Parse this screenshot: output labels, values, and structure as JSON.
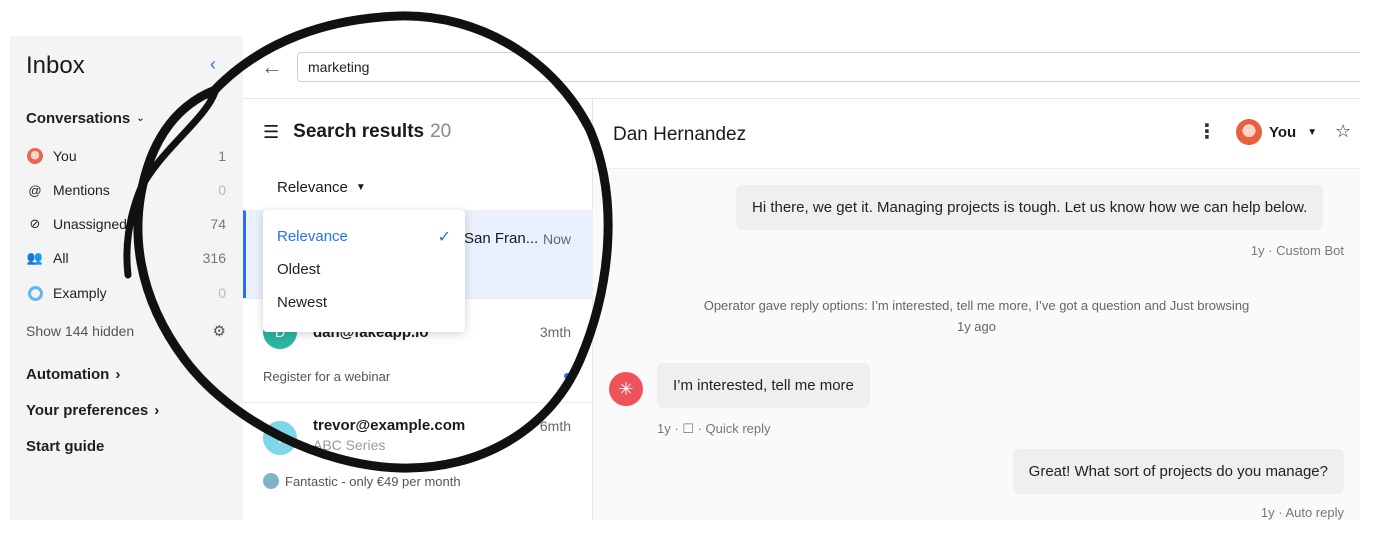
{
  "sidebar": {
    "title": "Inbox",
    "conversations_label": "Conversations",
    "items": [
      {
        "label": "You",
        "count": "1"
      },
      {
        "label": "Mentions",
        "count": "0"
      },
      {
        "label": "Unassigned",
        "count": "74"
      },
      {
        "label": "All",
        "count": "316"
      },
      {
        "label": "Examply",
        "count": "0"
      }
    ],
    "show_hidden": "Show 144 hidden",
    "automation": "Automation",
    "preferences": "Your preferences",
    "start_guide": "Start guide"
  },
  "search": {
    "value": "marketing"
  },
  "results": {
    "title": "Search results",
    "count": "20",
    "sort_label": "Relevance",
    "sort_options": [
      "Relevance",
      "Oldest",
      "Newest"
    ],
    "rows": [
      {
        "sender": "San Fran...",
        "time": "Now"
      },
      {
        "sender": "dan@fakeapp.io",
        "avatar": "D",
        "time": "3mth",
        "preview": "Register for a webinar"
      },
      {
        "sender": "trevor@example.com",
        "avatar": "T",
        "sub": "ABC Series",
        "time": "6mth",
        "preview": "Fantastic - only €49 per month"
      }
    ]
  },
  "conversation": {
    "name": "Dan Hernandez",
    "assignee": "You",
    "bot_message": "Hi there, we get it. Managing projects is tough. Let us know how we can help below.",
    "bot_meta": "1y · Custom Bot",
    "operator_note": "Operator gave reply options: I’m interested, tell me more, I’ve got a question and Just browsing",
    "operator_meta": "1y ago",
    "user_message": "I’m interested, tell me more",
    "user_meta": "1y · ☐ · Quick reply",
    "reply_message": "Great! What sort of projects do you manage?",
    "reply_meta": "1y · Auto reply"
  },
  "colors": {
    "accent": "#286efa",
    "sidebar_bg": "#f4f4f5",
    "selected_row": "#eaf1fe",
    "avatar_teal": "#2bb5a2",
    "avatar_cyan": "#7fd6e8",
    "user_avatar": "#f0525a"
  },
  "icons": [
    "collapse-icon",
    "chevron-down-icon",
    "at-icon",
    "unassigned-icon",
    "team-icon",
    "examply-icon",
    "gear-icon",
    "chevron-right-icon",
    "back-arrow-icon",
    "menu-icon",
    "check-icon",
    "kebab-icon",
    "star-icon"
  ]
}
